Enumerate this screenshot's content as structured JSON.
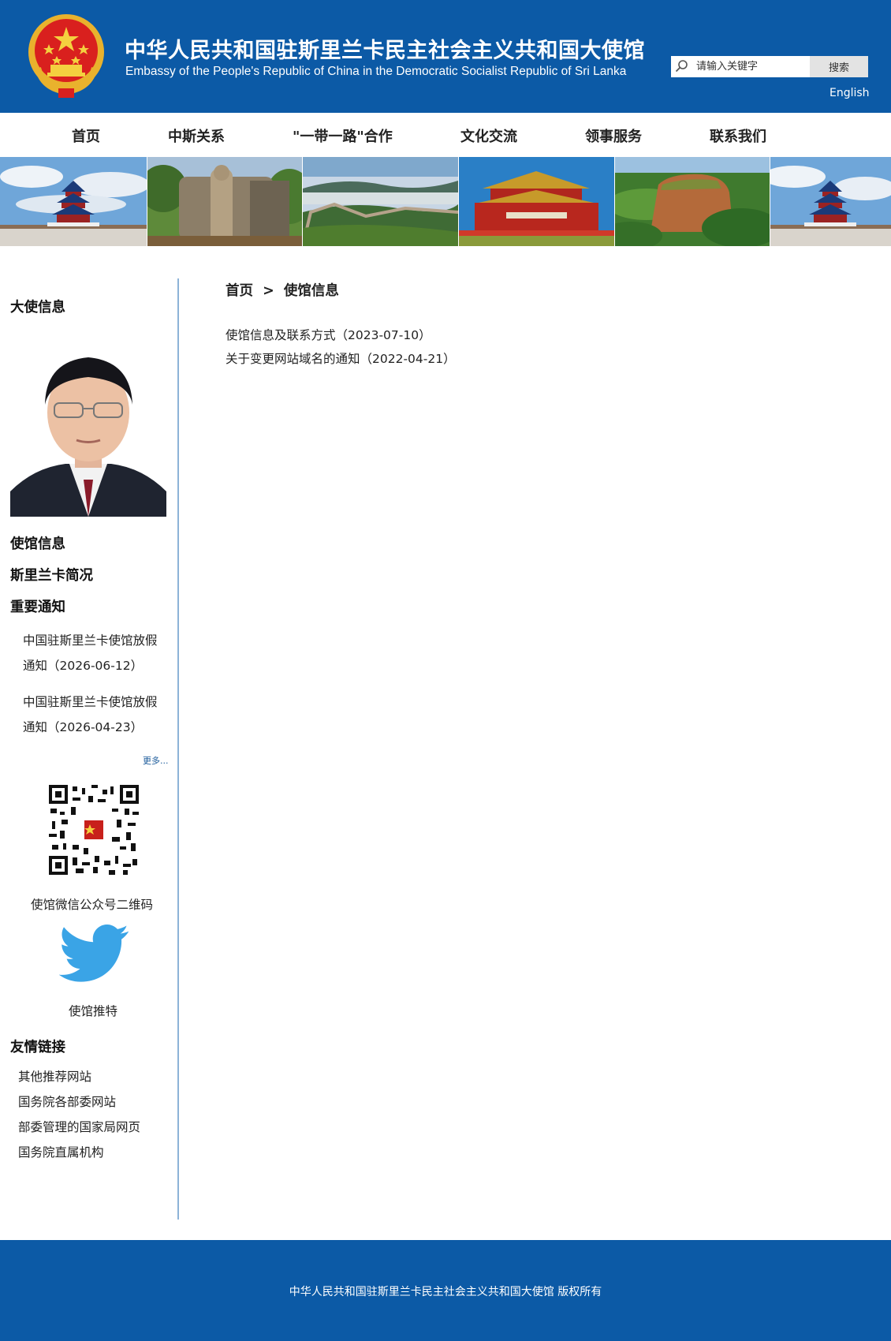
{
  "header": {
    "title_cn": "中华人民共和国驻斯里兰卡民主社会主义共和国大使馆",
    "title_en": "Embassy of the People's Republic of China in the Democratic Socialist Republic of Sri Lanka",
    "search": {
      "placeholder": "请输入关键字",
      "button_label": "搜索"
    },
    "language_link": "English"
  },
  "nav": {
    "items": [
      {
        "label": "首页"
      },
      {
        "label": "中斯关系"
      },
      {
        "label": "\"一带一路\"合作"
      },
      {
        "label": "文化交流"
      },
      {
        "label": "领事服务"
      },
      {
        "label": "联系我们"
      }
    ]
  },
  "banner": {
    "photos": [
      "temple-of-heaven",
      "avukana-buddha-statue",
      "great-wall",
      "tiananmen-gate",
      "sigiriya-rock",
      "temple-of-heaven"
    ]
  },
  "sidebar": {
    "ambassador_heading": "大使信息",
    "menu": [
      {
        "label": "使馆信息"
      },
      {
        "label": "斯里兰卡简况"
      },
      {
        "label": "重要通知"
      }
    ],
    "notices": [
      {
        "text": "中国驻斯里兰卡使馆放假通知（2026-06-12）"
      },
      {
        "text": "中国驻斯里兰卡使馆放假通知（2026-04-23）"
      }
    ],
    "more_label": "更多...",
    "qr_caption": "使馆微信公众号二维码",
    "twitter_caption": "使馆推特",
    "links_heading": "友情链接",
    "links": [
      {
        "label": "其他推荐网站"
      },
      {
        "label": "国务院各部委网站"
      },
      {
        "label": "部委管理的国家局网页"
      },
      {
        "label": "国务院直属机构"
      }
    ]
  },
  "main": {
    "breadcrumb": {
      "home": "首页",
      "separator": ">",
      "current": "使馆信息"
    },
    "articles": [
      {
        "title": "使馆信息及联系方式（2023-07-10）"
      },
      {
        "title": "关于变更网站域名的通知（2022-04-21）"
      }
    ]
  },
  "footer": {
    "copyright": "中华人民共和国驻斯里兰卡民主社会主义共和国大使馆 版权所有"
  },
  "colors": {
    "brand_blue": "#0c5aa6",
    "divider": "#8db3d8"
  }
}
